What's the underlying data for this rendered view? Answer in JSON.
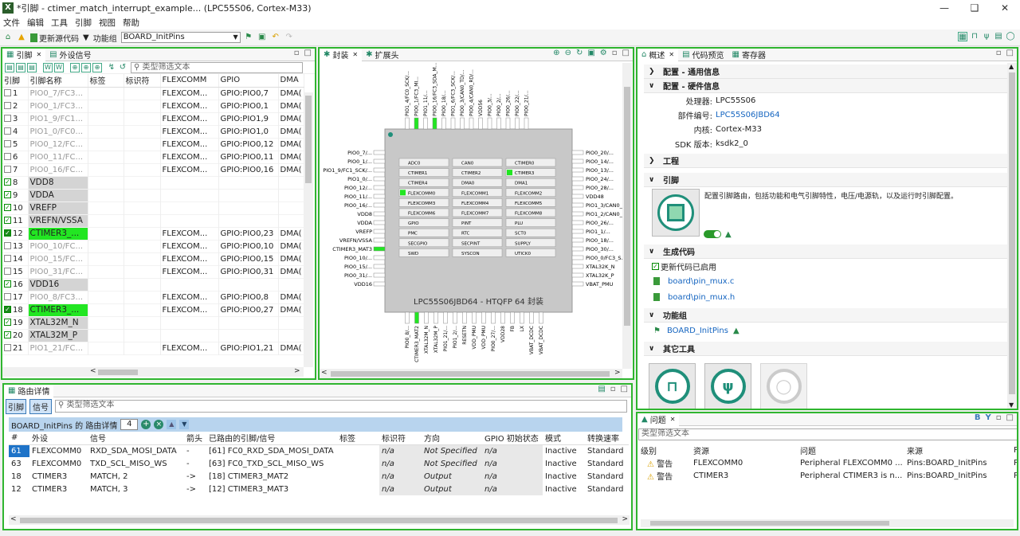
{
  "window": {
    "title": "*引脚 - ctimer_match_interrupt_example... (LPC55S06, Cortex-M33)",
    "app_icon": "X"
  },
  "menu": [
    "文件",
    "编辑",
    "工具",
    "引脚",
    "视图",
    "帮助"
  ],
  "toolbar": {
    "update_code": "更新源代码",
    "function_group_label": "功能组",
    "function_group_value": "BOARD_InitPins"
  },
  "pins_panel": {
    "tab_pins": "引脚",
    "tab_peripherals": "外设信号",
    "filter_placeholder": "类型筛选文本",
    "columns": [
      "引脚",
      "引脚名称",
      "标签",
      "标识符",
      "FLEXCOMM",
      "GPIO",
      "DMA"
    ],
    "rows": [
      {
        "num": "1",
        "name": "PIO0_7/FC3...",
        "flex": "FLEXCOM...",
        "gpio": "GPIO:PIO0,7",
        "dma": "DMA(",
        "checked": false,
        "style": "gray"
      },
      {
        "num": "2",
        "name": "PIO0_1/FC3...",
        "flex": "FLEXCOM...",
        "gpio": "GPIO:PIO0,1",
        "dma": "DMA(",
        "checked": false,
        "style": "gray"
      },
      {
        "num": "3",
        "name": "PIO1_9/FC1...",
        "flex": "FLEXCOM...",
        "gpio": "GPIO:PIO1,9",
        "dma": "DMA(",
        "checked": false,
        "style": "gray"
      },
      {
        "num": "4",
        "name": "PIO1_0/FC0...",
        "flex": "FLEXCOM...",
        "gpio": "GPIO:PIO1,0",
        "dma": "DMA(",
        "checked": false,
        "style": "gray"
      },
      {
        "num": "5",
        "name": "PIO0_12/FC...",
        "flex": "FLEXCOM...",
        "gpio": "GPIO:PIO0,12",
        "dma": "DMA(",
        "checked": false,
        "style": "gray"
      },
      {
        "num": "6",
        "name": "PIO0_11/FC...",
        "flex": "FLEXCOM...",
        "gpio": "GPIO:PIO0,11",
        "dma": "DMA(",
        "checked": false,
        "style": "gray"
      },
      {
        "num": "7",
        "name": "PIO0_16/FC...",
        "flex": "FLEXCOM...",
        "gpio": "GPIO:PIO0,16",
        "dma": "DMA(",
        "checked": false,
        "style": "gray"
      },
      {
        "num": "8",
        "name": "VDD8",
        "flex": "",
        "gpio": "",
        "dma": "",
        "checked": true,
        "style": "power"
      },
      {
        "num": "9",
        "name": "VDDA",
        "flex": "",
        "gpio": "",
        "dma": "",
        "checked": true,
        "style": "power"
      },
      {
        "num": "10",
        "name": "VREFP",
        "flex": "",
        "gpio": "",
        "dma": "",
        "checked": true,
        "style": "power"
      },
      {
        "num": "11",
        "name": "VREFN/VSSA",
        "flex": "",
        "gpio": "",
        "dma": "",
        "checked": true,
        "style": "power"
      },
      {
        "num": "12",
        "name": "CTIMER3_...",
        "flex": "FLEXCOM...",
        "gpio": "GPIO:PIO0,23",
        "dma": "DMA(",
        "checked": true,
        "style": "routed"
      },
      {
        "num": "13",
        "name": "PIO0_10/FC...",
        "flex": "FLEXCOM...",
        "gpio": "GPIO:PIO0,10",
        "dma": "DMA(",
        "checked": false,
        "style": "gray"
      },
      {
        "num": "14",
        "name": "PIO0_15/FC...",
        "flex": "FLEXCOM...",
        "gpio": "GPIO:PIO0,15",
        "dma": "DMA(",
        "checked": false,
        "style": "gray"
      },
      {
        "num": "15",
        "name": "PIO0_31/FC...",
        "flex": "FLEXCOM...",
        "gpio": "GPIO:PIO0,31",
        "dma": "DMA(",
        "checked": false,
        "style": "gray"
      },
      {
        "num": "16",
        "name": "VDD16",
        "flex": "",
        "gpio": "",
        "dma": "",
        "checked": true,
        "style": "power"
      },
      {
        "num": "17",
        "name": "PIO0_8/FC3...",
        "flex": "FLEXCOM...",
        "gpio": "GPIO:PIO0,8",
        "dma": "DMA(",
        "checked": false,
        "style": "gray"
      },
      {
        "num": "18",
        "name": "CTIMER3_...",
        "flex": "FLEXCOM...",
        "gpio": "GPIO:PIO0,27",
        "dma": "DMA(",
        "checked": true,
        "style": "routed"
      },
      {
        "num": "19",
        "name": "XTAL32M_N",
        "flex": "",
        "gpio": "",
        "dma": "",
        "checked": true,
        "style": "power"
      },
      {
        "num": "20",
        "name": "XTAL32M_P",
        "flex": "",
        "gpio": "",
        "dma": "",
        "checked": true,
        "style": "power"
      },
      {
        "num": "21",
        "name": "PIO1_21/FC...",
        "flex": "FLEXCOM...",
        "gpio": "GPIO:PIO1,21",
        "dma": "DMA(",
        "checked": false,
        "style": "gray"
      }
    ]
  },
  "package_panel": {
    "tab_package": "封装",
    "tab_peripherals": "扩展头",
    "chip_label": "LPC55S06JBD64 - HTQFP 64 封装",
    "left_pins": [
      "PIO0_7/...",
      "PIO0_1/...",
      "PIO1_9/FC1_SCK/...",
      "PIO1_0/...",
      "PIO0_12/...",
      "PIO0_11/...",
      "PIO0_16/...",
      "VDD8",
      "VDDA",
      "VREFP",
      "VREFN/VSSA",
      "CTIMER3_MAT3",
      "PIO0_10/...",
      "PIO0_15/...",
      "PIO0_31/...",
      "VDD16"
    ],
    "right_pins": [
      "PIO0_20/...",
      "PIO0_14/...",
      "PIO0_13/...",
      "PIO0_24/...",
      "PIO0_28/...",
      "VDD48",
      "PIO1_3/CAN0_...",
      "PIO1_2/CAN0_...",
      "PIO0_26/...",
      "PIO1_1/...",
      "PIO0_18/...",
      "PIO0_30/...",
      "PIO0_0/FC3_S...",
      "XTAL32K_N",
      "XTAL32K_P",
      "VBAT_PMU"
    ],
    "top_pins": [
      "PIO1_4/FC0_SCK/...",
      "PIO0_1/FC3_MI...",
      "PIO1_11/...",
      "PIO0_16/FC3_SDA_M...",
      "PIO0_18/...",
      "PIO1_6/FC3_SCK/...",
      "PIO0_3/CAN0_TD/...",
      "PIO0_4/CAN0_RD/...",
      "VDD56",
      "PIO0_3/...",
      "PIO0_2/...",
      "PIO0_26/...",
      "PIO0_22/...",
      "PIO0_21/..."
    ],
    "bottom_pins": [
      "PIO0_8/...",
      "CTIMER3_MAT2",
      "XTAL32M_N",
      "XTAL32M_P",
      "PIO1_21/...",
      "PIO1_2/...",
      "RESETN",
      "VDD_PMU",
      "VDD_PMU",
      "PIO0_27/...",
      "VDD28",
      "FB",
      "LX",
      "VBAT_DCDC",
      "VBAT_DCDC"
    ],
    "blocks": [
      [
        {
          "t": "ADC0",
          "on": false
        },
        {
          "t": "CAN0",
          "on": false
        },
        {
          "t": "CTIMER0",
          "on": false
        }
      ],
      [
        {
          "t": "CTIMER1",
          "on": false
        },
        {
          "t": "CTIMER2",
          "on": false
        },
        {
          "t": "CTIMER3",
          "on": true
        }
      ],
      [
        {
          "t": "CTIMER4",
          "on": false
        },
        {
          "t": "DMA0",
          "on": false
        },
        {
          "t": "DMA1",
          "on": false
        }
      ],
      [
        {
          "t": "FLEXCOMM0",
          "on": true
        },
        {
          "t": "FLEXCOMM1",
          "on": false
        },
        {
          "t": "FLEXCOMM2",
          "on": false
        }
      ],
      [
        {
          "t": "FLEXCOMM3",
          "on": false
        },
        {
          "t": "FLEXCOMM4",
          "on": false
        },
        {
          "t": "FLEXCOMM5",
          "on": false
        }
      ],
      [
        {
          "t": "FLEXCOMM6",
          "on": false
        },
        {
          "t": "FLEXCOMM7",
          "on": false
        },
        {
          "t": "FLEXCOMM8",
          "on": false
        }
      ],
      [
        {
          "t": "GPIO",
          "on": false
        },
        {
          "t": "PINT",
          "on": false
        },
        {
          "t": "PLU",
          "on": false
        }
      ],
      [
        {
          "t": "PMC",
          "on": false
        },
        {
          "t": "RTC",
          "on": false
        },
        {
          "t": "SCT0",
          "on": false
        }
      ],
      [
        {
          "t": "SECGPIO",
          "on": false
        },
        {
          "t": "SECPINT",
          "on": false
        },
        {
          "t": "SUPPLY",
          "on": false
        }
      ],
      [
        {
          "t": "SWD",
          "on": false
        },
        {
          "t": "SYSCON",
          "on": false
        },
        {
          "t": "UTICK0",
          "on": false
        }
      ]
    ]
  },
  "overview_panel": {
    "tab_overview": "概述",
    "tab_code_preview": "代码预览",
    "tab_registers": "寄存器",
    "sec_general": "配置 - 通用信息",
    "sec_hardware": "配置 - 硬件信息",
    "processor_k": "处理器:",
    "processor_v": "LPC55S06",
    "part_k": "部件编号:",
    "part_v": "LPC55S06JBD64",
    "core_k": "内核:",
    "core_v": "Cortex-M33",
    "sdk_k": "SDK 版本:",
    "sdk_v": "ksdk2_0",
    "sec_project": "工程",
    "sec_pins": "引脚",
    "pins_desc": "配置引脚路由，包括功能和电气引脚特性，电压/电源轨，以及运行时引脚配置。",
    "sec_gen": "生成代码",
    "gen_enabled": "更新代码已启用",
    "file1": "board\\pin_mux.c",
    "file2": "board\\pin_mux.h",
    "sec_fg": "功能组",
    "fg_item": "BOARD_InitPins",
    "sec_tools": "其它工具"
  },
  "routing_panel": {
    "tab": "路由详情",
    "btn_pins": "引脚",
    "btn_signals": "信号",
    "filter_placeholder": "类型筛选文本",
    "header_label": "BOARD_InitPins 的 路由详情",
    "count": "4",
    "columns": [
      "#",
      "外设",
      "信号",
      "箭头",
      "已路由的引脚/信号",
      "标签",
      "标识符",
      "方向",
      "GPIO 初始状态",
      "模式",
      "转换速率"
    ],
    "rows": [
      {
        "n": "61",
        "per": "FLEXCOMM0",
        "sig": "RXD_SDA_MOSI_DATA",
        "arr": "-",
        "routed": "[61] FC0_RXD_SDA_MOSI_DATA",
        "label": "",
        "ident": "n/a",
        "dir": "Not Specified",
        "gpio": "n/a",
        "mode": "Inactive",
        "slew": "Standard",
        "sel": true
      },
      {
        "n": "63",
        "per": "FLEXCOMM0",
        "sig": "TXD_SCL_MISO_WS",
        "arr": "-",
        "routed": "[63] FC0_TXD_SCL_MISO_WS",
        "label": "",
        "ident": "n/a",
        "dir": "Not Specified",
        "gpio": "n/a",
        "mode": "Inactive",
        "slew": "Standard",
        "sel": false
      },
      {
        "n": "18",
        "per": "CTIMER3",
        "sig": "MATCH, 2",
        "arr": "->",
        "routed": "[18] CTIMER3_MAT2",
        "label": "",
        "ident": "n/a",
        "dir": "Output",
        "gpio": "n/a",
        "mode": "Inactive",
        "slew": "Standard",
        "sel": false
      },
      {
        "n": "12",
        "per": "CTIMER3",
        "sig": "MATCH, 3",
        "arr": "->",
        "routed": "[12] CTIMER3_MAT3",
        "label": "",
        "ident": "n/a",
        "dir": "Output",
        "gpio": "n/a",
        "mode": "Inactive",
        "slew": "Standard",
        "sel": false
      }
    ]
  },
  "problems_panel": {
    "tab": "问题",
    "filter_placeholder": "类型筛选文本",
    "columns": [
      "级别",
      "资源",
      "问题",
      "来源",
      "P"
    ],
    "rows": [
      {
        "level": "警告",
        "res": "FLEXCOMM0",
        "issue": "Peripheral FLEXCOMM0 ...",
        "src": "Pins:BOARD_InitPins",
        "p": "P"
      },
      {
        "level": "警告",
        "res": "CTIMER3",
        "issue": "Peripheral CTIMER3 is n...",
        "src": "Pins:BOARD_InitPins",
        "p": "P"
      }
    ]
  },
  "colors": {
    "accent_green": "#2fb52f",
    "highlight_green": "#22e622",
    "link_blue": "#1565c0",
    "teal": "#1f8f7a"
  }
}
